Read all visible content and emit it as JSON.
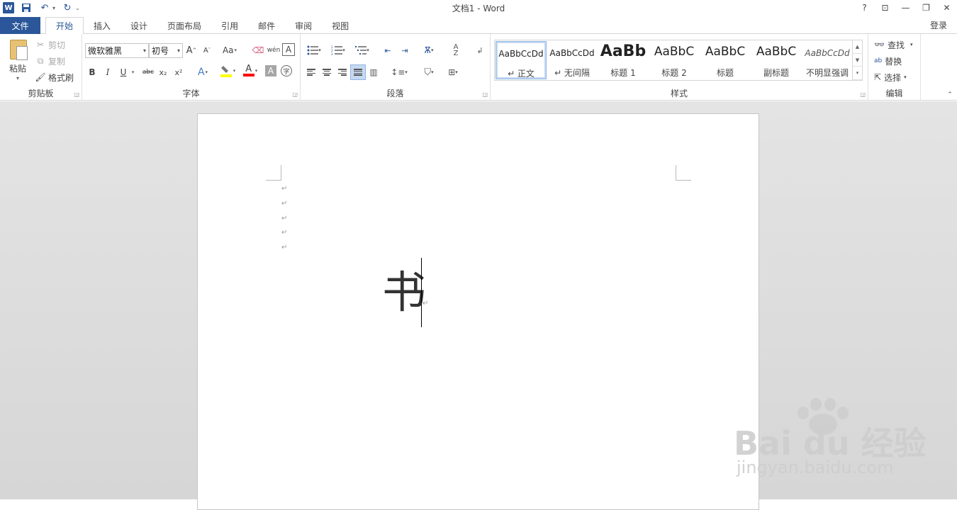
{
  "window": {
    "title": "文档1 - Word",
    "controls": [
      "?",
      "⊡",
      "—",
      "❐",
      "✕"
    ]
  },
  "tabs": {
    "file": "文件",
    "items": [
      "开始",
      "插入",
      "设计",
      "页面布局",
      "引用",
      "邮件",
      "审阅",
      "视图"
    ],
    "active": "开始",
    "signin": "登录"
  },
  "clipboard": {
    "paste": "粘贴",
    "cut": "剪切",
    "copy": "复制",
    "format_painter": "格式刷",
    "label": "剪贴板"
  },
  "font": {
    "name": "微软雅黑",
    "size": "初号",
    "label": "字体",
    "grow": "A",
    "shrink": "A",
    "case": "Aa",
    "phonetic": "wén",
    "bold": "B",
    "italic": "I",
    "underline": "U",
    "strike": "abc",
    "subscript": "x₂",
    "superscript": "x²",
    "effects": "A",
    "shading": "A",
    "enclose": "字"
  },
  "paragraph": {
    "label": "段落"
  },
  "styles": {
    "label": "样式",
    "items": [
      {
        "sample": "AaBbCcDd",
        "name": "↵ 正文"
      },
      {
        "sample": "AaBbCcDd",
        "name": "↵ 无间隔"
      },
      {
        "sample": "AaBb",
        "name": "标题 1"
      },
      {
        "sample": "AaBbC",
        "name": "标题 2"
      },
      {
        "sample": "AaBbC",
        "name": "标题"
      },
      {
        "sample": "AaBbC",
        "name": "副标题"
      },
      {
        "sample": "AaBbCcDd",
        "name": "不明显强调"
      }
    ]
  },
  "editing": {
    "find": "查找",
    "replace": "替换",
    "select": "选择",
    "label": "编辑"
  },
  "document": {
    "paragraph_mark": "↵",
    "content": "书"
  },
  "watermark": {
    "brand": "Bai du 经验",
    "url": "jingyan.baidu.com"
  },
  "colors": {
    "accent": "#2b579a",
    "highlight": "#ffff00",
    "font_color": "#ff0000"
  }
}
